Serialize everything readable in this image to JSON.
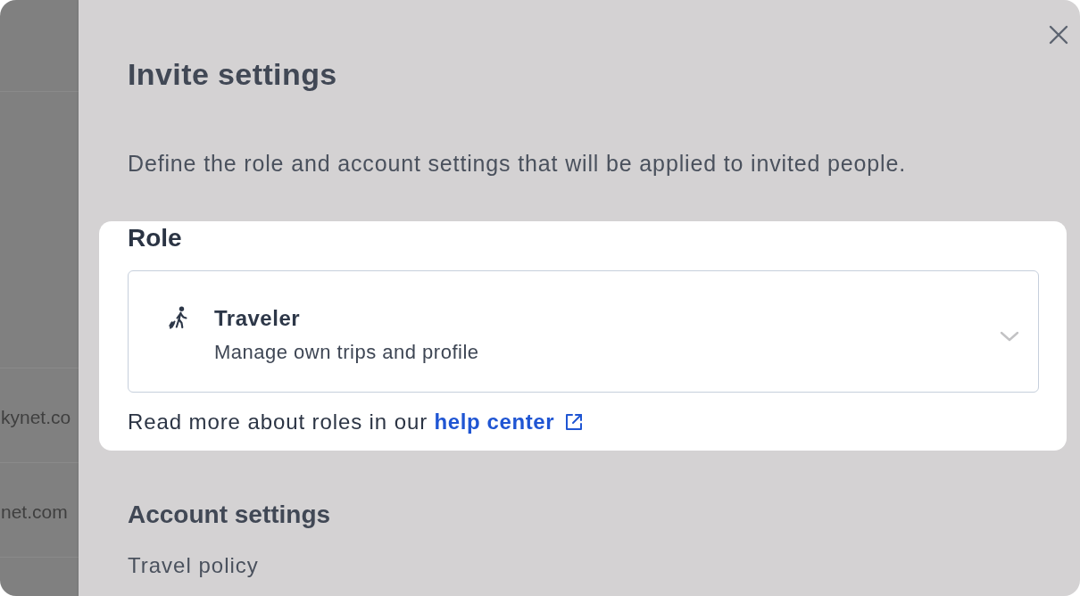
{
  "background_table": {
    "rows": [
      {
        "cell": "kynet.co"
      },
      {
        "cell": "net.com"
      }
    ]
  },
  "drawer": {
    "title": "Invite settings",
    "description": "Define the role and account settings that will be applied to invited people.",
    "role_section": {
      "highlighted": true,
      "heading": "Role",
      "role_select": {
        "title": "Traveler",
        "subtitle": "Manage own trips and profile"
      },
      "help_text": "Read more about roles in our",
      "help_link": "help center"
    },
    "account_settings": {
      "heading": "Account settings",
      "items": [
        "Travel policy"
      ]
    }
  }
}
